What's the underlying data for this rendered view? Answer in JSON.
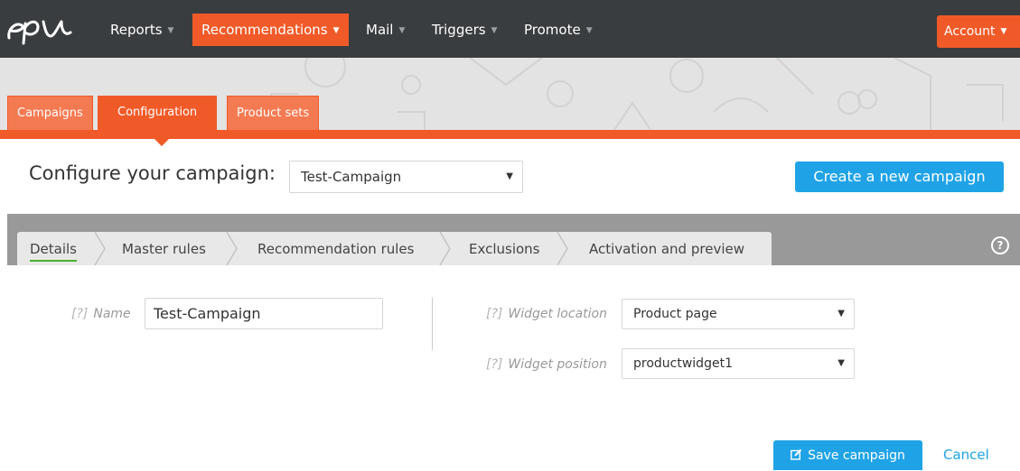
{
  "nav": {
    "logo": "epi",
    "items": [
      {
        "label": "Reports",
        "active": false
      },
      {
        "label": "Recommendations",
        "active": true
      },
      {
        "label": "Mail",
        "active": false
      },
      {
        "label": "Triggers",
        "active": false
      },
      {
        "label": "Promote",
        "active": false
      }
    ],
    "account_label": "Account"
  },
  "main_tabs": [
    {
      "label": "Campaigns",
      "active": false
    },
    {
      "label": "Configuration",
      "active": true
    },
    {
      "label": "Product sets",
      "active": false
    }
  ],
  "configure": {
    "title": "Configure your campaign:",
    "selected_campaign": "Test-Campaign",
    "create_button": "Create a new campaign"
  },
  "steps": [
    {
      "label": "Details",
      "active": true
    },
    {
      "label": "Master rules",
      "active": false
    },
    {
      "label": "Recommendation rules",
      "active": false
    },
    {
      "label": "Exclusions",
      "active": false
    },
    {
      "label": "Activation and preview",
      "active": false
    }
  ],
  "help_glyph": "?",
  "form": {
    "hint": "[?]",
    "name_label": "Name",
    "name_value": "Test-Campaign",
    "widget_location_label": "Widget location",
    "widget_location_value": "Product page",
    "widget_position_label": "Widget position",
    "widget_position_value": "productwidget1"
  },
  "actions": {
    "save_label": "Save campaign",
    "cancel_label": "Cancel"
  },
  "colors": {
    "accent_orange": "#f05a28",
    "nav_dark": "#3a3d3f",
    "primary_blue": "#1fa3e6",
    "step_active_underline": "#4caf2e"
  }
}
